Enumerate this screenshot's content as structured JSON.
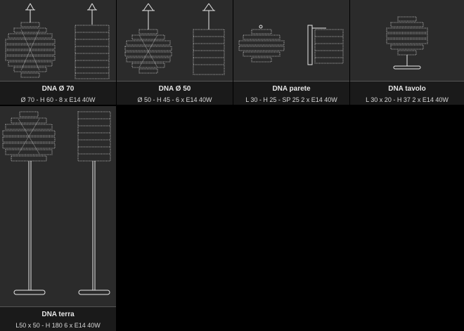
{
  "products": [
    {
      "title": "DNA Ø 70",
      "spec": "Ø 70 - H 60 - 8 x E14 40W"
    },
    {
      "title": "DNA Ø 50",
      "spec": "Ø 50 - H 45 - 6 x E14 40W"
    },
    {
      "title": "DNA parete",
      "spec": "L 30 - H 25 - SP 25 2 x E14 40W"
    },
    {
      "title": "DNA tavolo",
      "spec": "L 30 x 20 - H 37 2 x E14 40W"
    },
    {
      "title": "DNA terra",
      "spec": "L50 x 50 - H 180 6 x E14 40W"
    }
  ],
  "colors": {
    "card_bg": "#2b2b2b",
    "caption_bg": "#1a1a1a",
    "text": "#e6e6e6",
    "page_bg": "#000000"
  }
}
